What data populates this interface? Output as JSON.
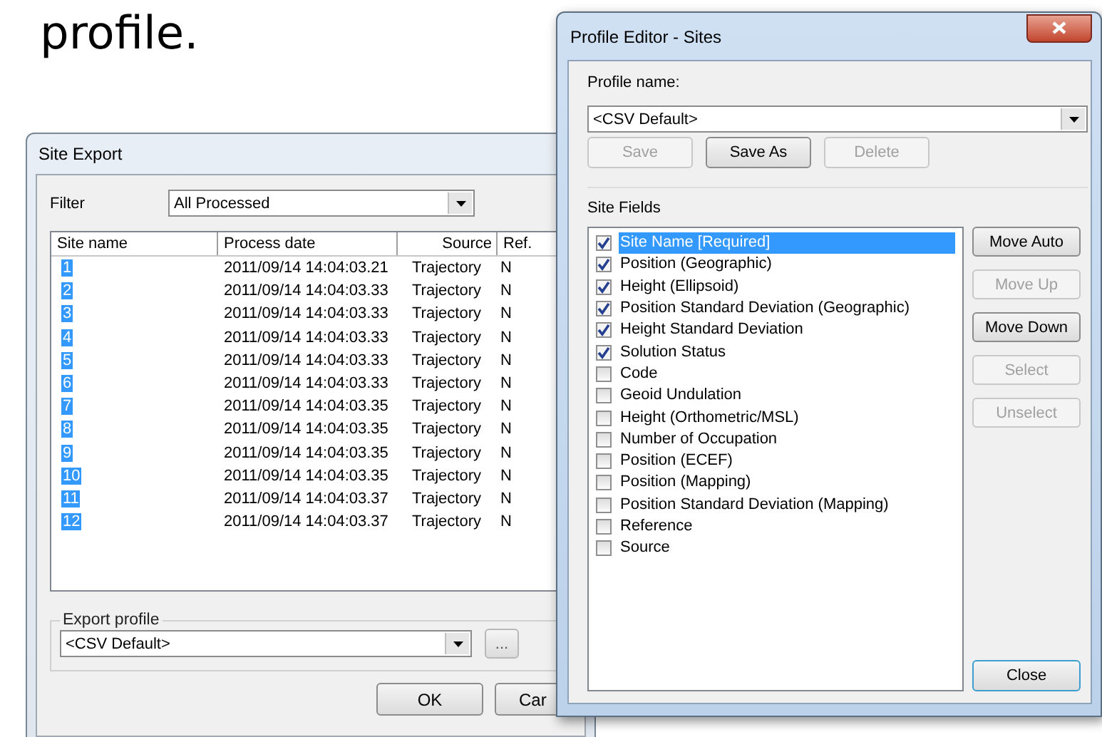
{
  "slide_text": "profile.",
  "site_export": {
    "title": "Site Export",
    "filter": {
      "label": "Filter",
      "value": "All Processed"
    },
    "table": {
      "columns": [
        "Site name",
        "Process date",
        "Source",
        "Ref."
      ],
      "rows": [
        {
          "cells": [
            "1",
            "2011/09/14 14:04:03.21",
            "Trajectory",
            "N"
          ],
          "selected": true
        },
        {
          "cells": [
            "2",
            "2011/09/14 14:04:03.33",
            "Trajectory",
            "N"
          ],
          "selected": true
        },
        {
          "cells": [
            "3",
            "2011/09/14 14:04:03.33",
            "Trajectory",
            "N"
          ],
          "selected": true
        },
        {
          "cells": [
            "4",
            "2011/09/14 14:04:03.33",
            "Trajectory",
            "N"
          ],
          "selected": true
        },
        {
          "cells": [
            "5",
            "2011/09/14 14:04:03.33",
            "Trajectory",
            "N"
          ],
          "selected": true
        },
        {
          "cells": [
            "6",
            "2011/09/14 14:04:03.33",
            "Trajectory",
            "N"
          ],
          "selected": true
        },
        {
          "cells": [
            "7",
            "2011/09/14 14:04:03.35",
            "Trajectory",
            "N"
          ],
          "selected": true
        },
        {
          "cells": [
            "8",
            "2011/09/14 14:04:03.35",
            "Trajectory",
            "N"
          ],
          "selected": true
        },
        {
          "cells": [
            "9",
            "2011/09/14 14:04:03.35",
            "Trajectory",
            "N"
          ],
          "selected": true
        },
        {
          "cells": [
            "10",
            "2011/09/14 14:04:03.35",
            "Trajectory",
            "N"
          ],
          "selected": true
        },
        {
          "cells": [
            "11",
            "2011/09/14 14:04:03.37",
            "Trajectory",
            "N"
          ],
          "selected": true
        },
        {
          "cells": [
            "12",
            "2011/09/14 14:04:03.37",
            "Trajectory",
            "N"
          ],
          "selected": true
        }
      ]
    },
    "export_profile": {
      "label": "Export profile",
      "value": "<CSV Default>",
      "browse": "..."
    },
    "buttons": [
      "OK",
      "Car"
    ]
  },
  "profile_editor": {
    "title": "Profile Editor - Sites",
    "profile_name_label": "Profile name:",
    "profile_name": "<CSV Default>",
    "buttons": [
      {
        "label": "Save",
        "disabled": true
      },
      {
        "label": "Save As",
        "disabled": false
      },
      {
        "label": "Delete",
        "disabled": true
      }
    ],
    "site_fields_label": "Site Fields",
    "fields": [
      {
        "label": "Site Name [Required]",
        "checked": true,
        "selected": true
      },
      {
        "label": "Position (Geographic)",
        "checked": true,
        "selected": false
      },
      {
        "label": "Height (Ellipsoid)",
        "checked": true,
        "selected": false
      },
      {
        "label": "Position Standard Deviation (Geographic)",
        "checked": true,
        "selected": false
      },
      {
        "label": "Height Standard Deviation",
        "checked": true,
        "selected": false
      },
      {
        "label": "Solution Status",
        "checked": true,
        "selected": false
      },
      {
        "label": "Code",
        "checked": false,
        "selected": false
      },
      {
        "label": "Geoid Undulation",
        "checked": false,
        "selected": false
      },
      {
        "label": "Height (Orthometric/MSL)",
        "checked": false,
        "selected": false
      },
      {
        "label": "Number of Occupation",
        "checked": false,
        "selected": false
      },
      {
        "label": "Position (ECEF)",
        "checked": false,
        "selected": false
      },
      {
        "label": "Position (Mapping)",
        "checked": false,
        "selected": false
      },
      {
        "label": "Position Standard Deviation (Mapping)",
        "checked": false,
        "selected": false
      },
      {
        "label": "Reference",
        "checked": false,
        "selected": false
      },
      {
        "label": "Source",
        "checked": false,
        "selected": false
      }
    ],
    "side_buttons": [
      {
        "label": "Move Auto",
        "disabled": false
      },
      {
        "label": "Move Up",
        "disabled": true
      },
      {
        "label": "Move Down",
        "disabled": false
      },
      {
        "label": "Select",
        "disabled": true
      },
      {
        "label": "Unselect",
        "disabled": true
      }
    ],
    "close": "Close"
  }
}
